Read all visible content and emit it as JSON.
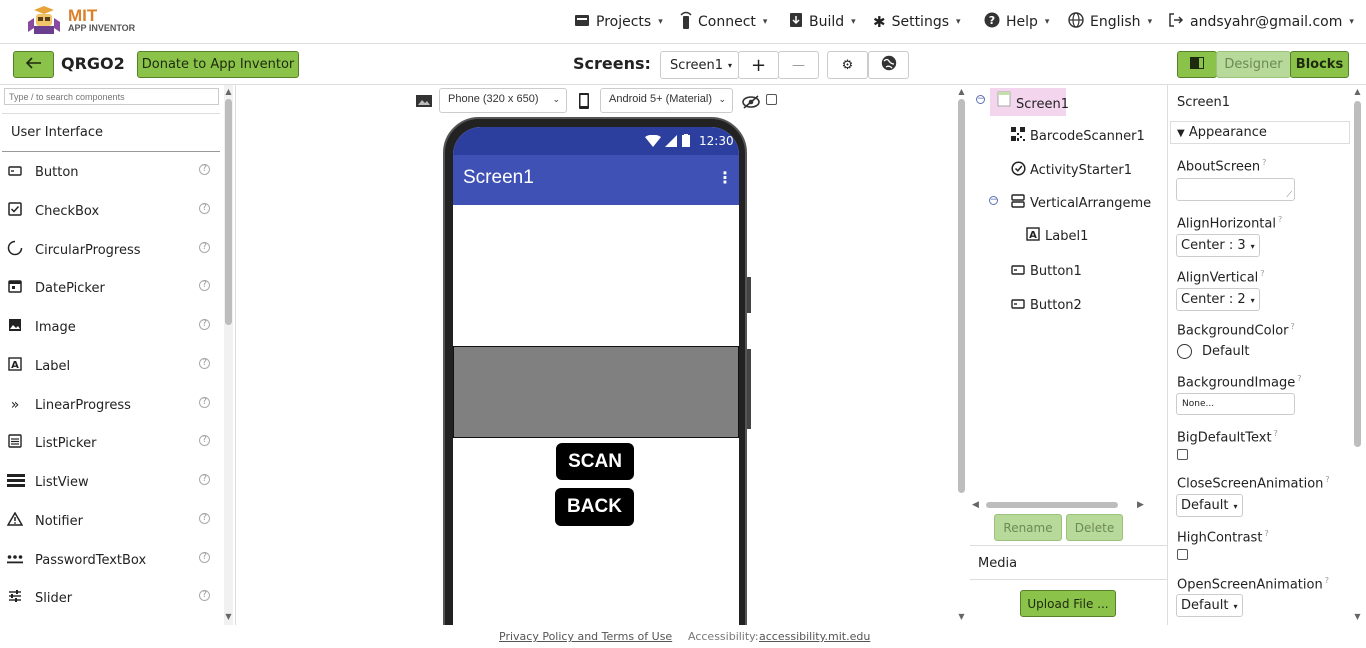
{
  "header": {
    "logo_mit": "MIT",
    "logo_sub": "APP INVENTOR",
    "menus": [
      {
        "label": "Projects",
        "icon": "folder-icon"
      },
      {
        "label": "Connect",
        "icon": "connect-icon"
      },
      {
        "label": "Build",
        "icon": "download-icon"
      },
      {
        "label": "Settings",
        "icon": "gear-icon"
      },
      {
        "label": "Help",
        "icon": "help-icon"
      },
      {
        "label": "English",
        "icon": "globe-icon"
      },
      {
        "label": "andsyahr@gmail.com",
        "icon": "logout-icon"
      }
    ]
  },
  "toolbar": {
    "back_icon": "arrow-left-icon",
    "project_name": "QRGO2",
    "donate_label": "Donate to App Inventor",
    "screens_label": "Screens:",
    "screen_select": "Screen1",
    "add_label": "+",
    "remove_label": "—",
    "designer_label": "Designer",
    "blocks_label": "Blocks"
  },
  "palette": {
    "search_placeholder": "Type / to search components",
    "category": "User Interface",
    "items": [
      {
        "label": "Button",
        "icon": "button-icon"
      },
      {
        "label": "CheckBox",
        "icon": "checkbox-icon"
      },
      {
        "label": "CircularProgress",
        "icon": "circular-progress-icon"
      },
      {
        "label": "DatePicker",
        "icon": "calendar-icon"
      },
      {
        "label": "Image",
        "icon": "image-icon"
      },
      {
        "label": "Label",
        "icon": "label-icon"
      },
      {
        "label": "LinearProgress",
        "icon": "linear-progress-icon"
      },
      {
        "label": "ListPicker",
        "icon": "list-icon"
      },
      {
        "label": "ListView",
        "icon": "listview-icon"
      },
      {
        "label": "Notifier",
        "icon": "warning-icon"
      },
      {
        "label": "PasswordTextBox",
        "icon": "password-icon"
      },
      {
        "label": "Slider",
        "icon": "slider-icon"
      }
    ]
  },
  "viewer": {
    "device_select": "Phone (320 x 650)",
    "theme_select": "Android 5+ (Material)",
    "time": "12:30",
    "app_title": "Screen1",
    "scan_label": "SCAN",
    "back_label": "BACK"
  },
  "tree": {
    "nodes": [
      {
        "label": "Screen1",
        "icon": "screen-icon"
      },
      {
        "label": "BarcodeScanner1",
        "icon": "qr-icon"
      },
      {
        "label": "ActivityStarter1",
        "icon": "check-circle-icon"
      },
      {
        "label": "VerticalArrangeme",
        "icon": "vertical-arrangement-icon"
      },
      {
        "label": "Label1",
        "icon": "label-icon"
      },
      {
        "label": "Button1",
        "icon": "button-icon"
      },
      {
        "label": "Button2",
        "icon": "button-icon"
      }
    ],
    "rename_label": "Rename",
    "delete_label": "Delete",
    "media_label": "Media",
    "upload_label": "Upload File ..."
  },
  "props": {
    "component": "Screen1",
    "section": "Appearance",
    "about_screen_label": "AboutScreen",
    "align_horizontal_label": "AlignHorizontal",
    "align_horizontal_value": "Center : 3",
    "align_vertical_label": "AlignVertical",
    "align_vertical_value": "Center : 2",
    "bg_color_label": "BackgroundColor",
    "bg_color_value": "Default",
    "bg_image_label": "BackgroundImage",
    "bg_image_value": "None...",
    "big_text_label": "BigDefaultText",
    "close_anim_label": "CloseScreenAnimation",
    "close_anim_value": "Default",
    "high_contrast_label": "HighContrast",
    "open_anim_label": "OpenScreenAnimation",
    "open_anim_value": "Default"
  },
  "footer": {
    "privacy": "Privacy Policy and Terms of Use",
    "access_label": "Accessibility:",
    "access_link": "accessibility.mit.edu"
  },
  "colors": {
    "accent_green": "#8bc34a",
    "app_bar": "#3f51b5",
    "selected_tree": "#f3d6ee"
  }
}
